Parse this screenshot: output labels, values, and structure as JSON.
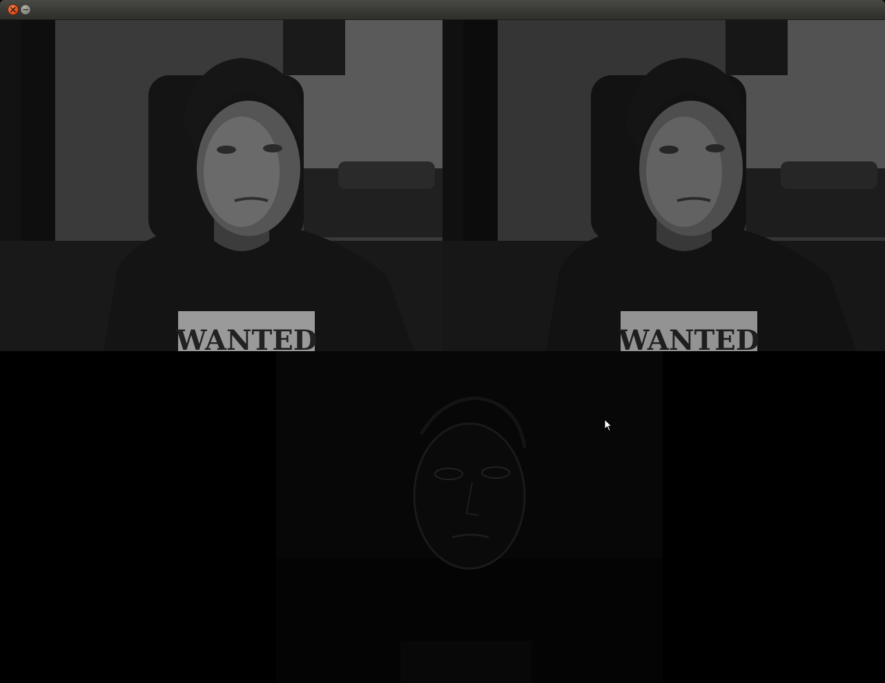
{
  "window": {
    "title": "",
    "buttons": {
      "close_icon": "close-icon",
      "minimize_icon": "minimize-icon"
    }
  },
  "panes": [
    {
      "id": "camera-feed-left",
      "shirt_text": "WANTED"
    },
    {
      "id": "camera-feed-right",
      "shirt_text": "WANTED"
    },
    {
      "id": "edge-filter-output",
      "shirt_text": ""
    }
  ],
  "colors": {
    "titlebar": "#3a3a36",
    "close_button": "#e0501d",
    "minimize_button": "#86857e",
    "background": "#000000"
  }
}
